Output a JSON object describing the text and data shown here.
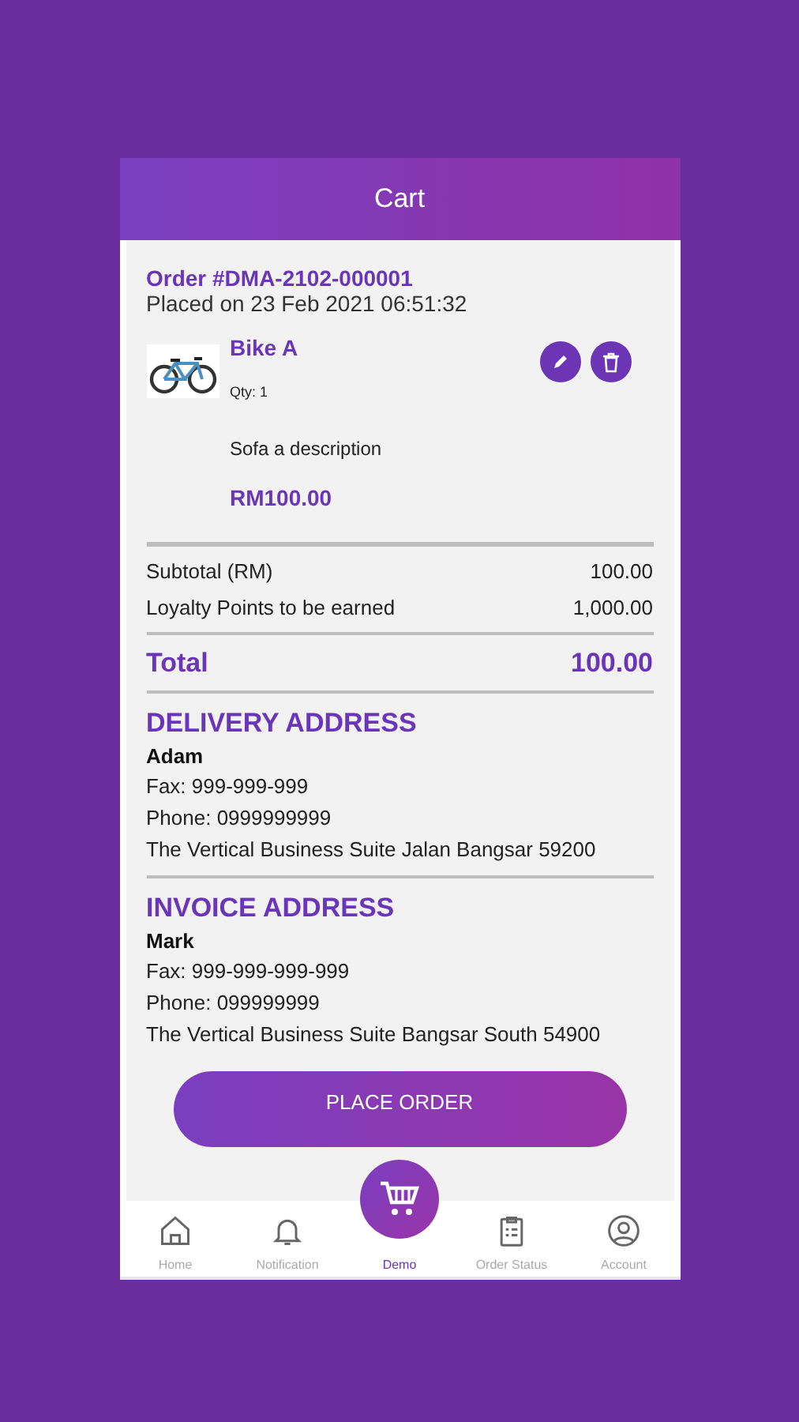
{
  "header": {
    "title": "Cart"
  },
  "order": {
    "number": "Order #DMA-2102-000001",
    "placed": "Placed on 23 Feb 2021 06:51:32"
  },
  "items": [
    {
      "name": "Bike A",
      "qty": "Qty: 1",
      "description": "Sofa a description",
      "price": "RM100.00"
    }
  ],
  "summary": [
    {
      "label": "Subtotal (RM)",
      "value": "100.00"
    },
    {
      "label": "Loyalty Points to be earned",
      "value": "1,000.00"
    }
  ],
  "total": {
    "label": "Total",
    "value": "100.00"
  },
  "addresses": [
    {
      "heading": "DELIVERY ADDRESS",
      "name": "Adam",
      "lines": [
        "Fax: 999-999-999",
        "Phone: 0999999999",
        "The Vertical Business Suite Jalan Bangsar 59200"
      ]
    },
    {
      "heading": "INVOICE ADDRESS",
      "name": "Mark",
      "lines": [
        "Fax: 999-999-999-999",
        "Phone: 099999999",
        "The Vertical Business Suite Bangsar South 54900"
      ]
    }
  ],
  "place_order": "PLACE ORDER",
  "nav": [
    {
      "label": "Home",
      "selected": false
    },
    {
      "label": "Notification",
      "selected": false
    },
    {
      "label": "Demo",
      "selected": true
    },
    {
      "label": "Order Status",
      "selected": false
    },
    {
      "label": "Account",
      "selected": false
    }
  ]
}
